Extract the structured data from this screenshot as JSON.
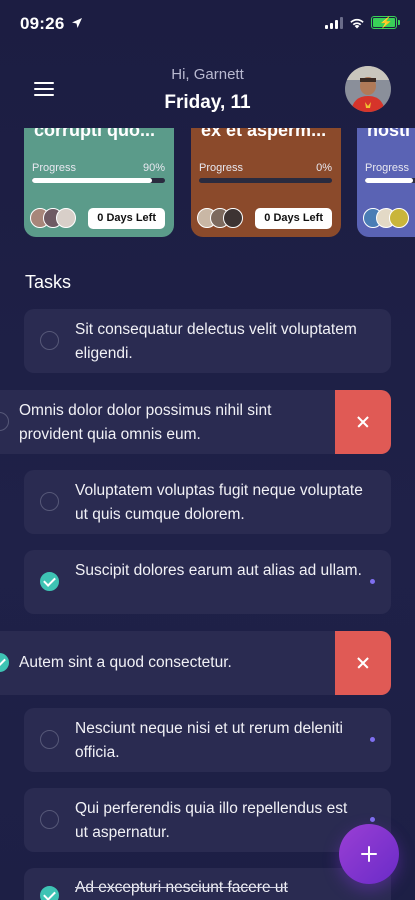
{
  "status_bar": {
    "time": "09:26"
  },
  "header": {
    "greeting": "Hi, Garnett",
    "date": "Friday, 11"
  },
  "projects": [
    {
      "title": "corrupti quo...",
      "progress_label": "Progress",
      "progress_text": "90%",
      "progress": 0.9,
      "days_left": "0 Days Left",
      "color": "#5b9b8a"
    },
    {
      "title": "ex et asperm...",
      "progress_label": "Progress",
      "progress_text": "0%",
      "progress": 0.0,
      "days_left": "0 Days Left",
      "color": "#8b4a2b"
    },
    {
      "title": "nosti",
      "progress_label": "Progress",
      "progress": 0.25,
      "color": "#5a63b4"
    }
  ],
  "tasks_title": "Tasks",
  "tasks": [
    {
      "text": "Sit consequatur delectus velit voluptatem eligendi.",
      "done": false
    },
    {
      "text": "Omnis dolor dolor possimus nihil sint provident quia omnis eum.",
      "done": false,
      "swiped": true
    },
    {
      "text": "Voluptatem voluptas fugit neque voluptate ut quis cumque dolorem.",
      "done": false
    },
    {
      "text": "Suscipit dolores earum aut alias ad ullam.",
      "done": true
    },
    {
      "text": "Autem sint a quod consectetur.",
      "done": true,
      "swiped": true
    },
    {
      "text": "Nesciunt neque nisi et ut rerum deleniti officia.",
      "done": false
    },
    {
      "text": "Qui perferendis quia illo repellendus est ut aspernatur.",
      "done": false
    },
    {
      "text": "Ad excepturi nesciunt facere ut",
      "done": true
    }
  ],
  "colors": {
    "background": "#1d1f45",
    "task_bg": "#2a2b51",
    "done_check": "#3ec3b4",
    "delete": "#e05a55",
    "fab": "#8a36d0",
    "accent_dot": "#7f6ff0"
  },
  "icons": {
    "menu": "hamburger-icon",
    "delete": "close-icon",
    "fab": "plus-icon",
    "location": "location-arrow-icon"
  }
}
